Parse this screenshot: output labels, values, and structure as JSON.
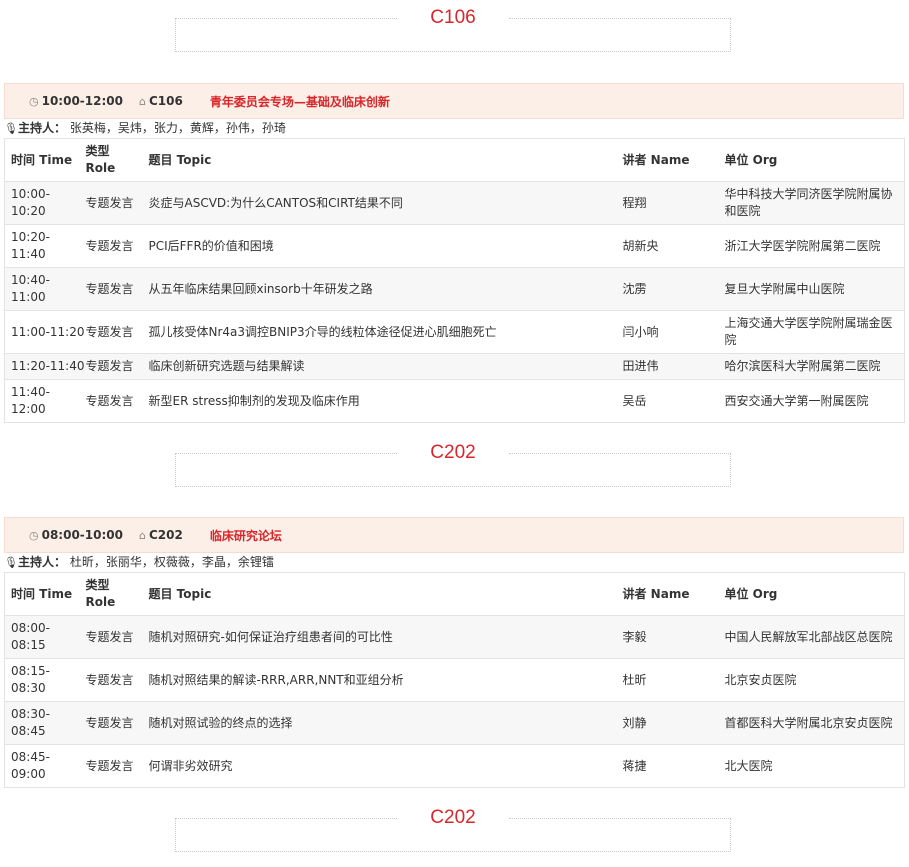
{
  "headers": [
    "时间 Time",
    "类型\nRole",
    "题目 Topic",
    "讲者 Name",
    "单位 Org"
  ],
  "room_headers": [
    "C106",
    "C202",
    "C202"
  ],
  "sessions": [
    {
      "time": "10:00-12:00",
      "room": "C106",
      "title": "青年委员会专场—基础及临床创新",
      "hosts_label": "主持人：",
      "hosts": "张英梅，吴炜，张力，黄辉，孙伟，孙琦",
      "rows": [
        {
          "time": "10:00-\n10:20",
          "role": "专题发言",
          "topic": "炎症与ASCVD:为什么CANTOS和CIRT结果不同",
          "name": "程翔",
          "org": "华中科技大学同济医学院附属协和医院"
        },
        {
          "time": "10:20-\n11:40",
          "role": "专题发言",
          "topic": "PCI后FFR的价值和困境",
          "name": "胡新央",
          "org": "浙江大学医学院附属第二医院"
        },
        {
          "time": "10:40-\n11:00",
          "role": "专题发言",
          "topic": "从五年临床结果回顾xinsorb十年研发之路",
          "name": "沈雳",
          "org": "复旦大学附属中山医院"
        },
        {
          "time": "11:00-11:20",
          "role": "专题发言",
          "topic": "孤儿核受体Nr4a3调控BNIP3介导的线粒体途径促进心肌细胞死亡",
          "name": "闫小响",
          "org": "上海交通大学医学院附属瑞金医院"
        },
        {
          "time": "11:20-11:40",
          "role": "专题发言",
          "topic": "临床创新研究选题与结果解读",
          "name": "田进伟",
          "org": "哈尔滨医科大学附属第二医院"
        },
        {
          "time": "11:40-\n12:00",
          "role": "专题发言",
          "topic": "新型ER stress抑制剂的发现及临床作用",
          "name": "吴岳",
          "org": "西安交通大学第一附属医院"
        }
      ]
    },
    {
      "time": "08:00-10:00",
      "room": "C202",
      "title": "临床研究论坛",
      "hosts_label": "主持人：",
      "hosts": "杜昕，张丽华，权薇薇，李晶，余锂镭",
      "rows": [
        {
          "time": "08:00-\n08:15",
          "role": "专题发言",
          "topic": "随机对照研究-如何保证治疗组患者间的可比性",
          "name": "李毅",
          "org": "中国人民解放军北部战区总医院"
        },
        {
          "time": "08:15-\n08:30",
          "role": "专题发言",
          "topic": "随机对照结果的解读-RRR,ARR,NNT和亚组分析",
          "name": "杜昕",
          "org": "北京安贞医院"
        },
        {
          "time": "08:30-\n08:45",
          "role": "专题发言",
          "topic": "随机对照试验的终点的选择",
          "name": "刘静",
          "org": "首都医科大学附属北京安贞医院"
        },
        {
          "time": "08:45-\n09:00",
          "role": "专题发言",
          "topic": "何谓非劣效研究",
          "name": "蒋捷",
          "org": "北大医院"
        }
      ]
    }
  ]
}
